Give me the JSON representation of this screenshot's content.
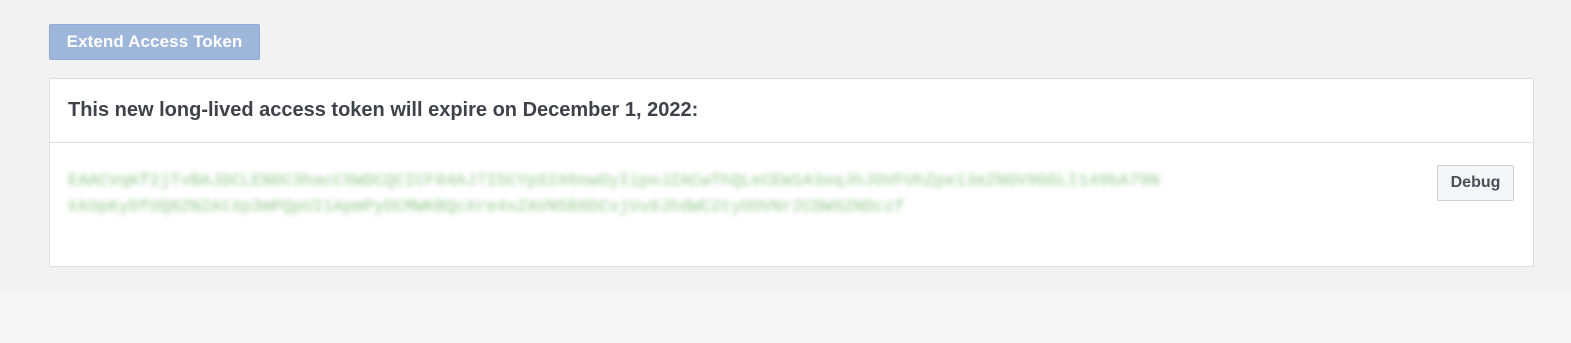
{
  "toolbar": {
    "extend_label": "Extend Access Token"
  },
  "token_panel": {
    "title": "This new long-lived access token will expire on December 1, 2022:",
    "token": "EAACVqKf2jTvBAJDCLENDC3hacC5WDCQCICF84AJ7I5CYpSI96owOyIipoJZACwThQLeCEW1A3oqJhJOVFUhZpe13eZNOV9GGLI149bA79NkkOpKyDfOQ8ZNZAtXp3mPQpUI1ApmPyDCMWKBQcXre4xZAVN5B8DCvjVu9JhdWC2tyOOVNr2CDW9ZNDczf",
    "debug_label": "Debug"
  },
  "colors": {
    "accent_button": "#9fb6db",
    "token_text": "#94c98d",
    "title_text": "#3e4249"
  }
}
